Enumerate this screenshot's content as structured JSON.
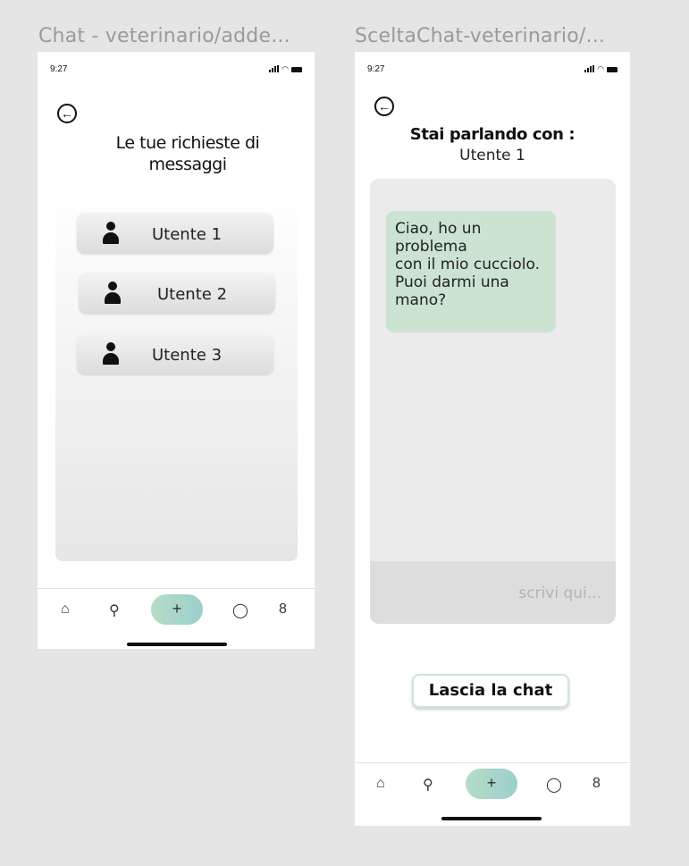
{
  "frames": [
    {
      "title": "Chat - veterinario/adde...",
      "status_time": "9:27",
      "heading": "Le tue richieste di messaggi",
      "users": [
        "Utente 1",
        "Utente 2",
        "Utente 3"
      ],
      "nav": {
        "home": "⌂",
        "map": "⚲",
        "plus": "+",
        "chat": "◯",
        "profile": "8"
      }
    },
    {
      "title": "SceltaChat-veterinario/...",
      "status_time": "9:27",
      "heading": "Stai parlando con :",
      "subheading": "Utente 1",
      "message": "Ciao, ho un\nproblema\ncon il mio cucciolo.\nPuoi darmi una\nmano?",
      "input_placeholder": "scrivi qui...",
      "leave_button": "Lascia la chat",
      "nav": {
        "home": "⌂",
        "map": "⚲",
        "plus": "+",
        "chat": "◯",
        "profile": "8"
      }
    }
  ],
  "colors": {
    "canvas": "#e5e5e5",
    "bubble": "#cce3d2",
    "accent": "#a9d6c9"
  }
}
